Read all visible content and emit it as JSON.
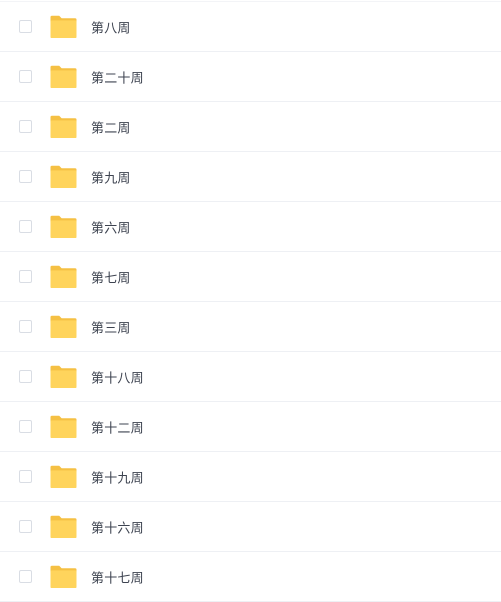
{
  "file_list": {
    "items": [
      {
        "name": "第八周",
        "icon": "folder-icon",
        "checked": false
      },
      {
        "name": "第二十周",
        "icon": "folder-icon",
        "checked": false
      },
      {
        "name": "第二周",
        "icon": "folder-icon",
        "checked": false
      },
      {
        "name": "第九周",
        "icon": "folder-icon",
        "checked": false
      },
      {
        "name": "第六周",
        "icon": "folder-icon",
        "checked": false
      },
      {
        "name": "第七周",
        "icon": "folder-icon",
        "checked": false
      },
      {
        "name": "第三周",
        "icon": "folder-icon",
        "checked": false
      },
      {
        "name": "第十八周",
        "icon": "folder-icon",
        "checked": false
      },
      {
        "name": "第十二周",
        "icon": "folder-icon",
        "checked": false
      },
      {
        "name": "第十九周",
        "icon": "folder-icon",
        "checked": false
      },
      {
        "name": "第十六周",
        "icon": "folder-icon",
        "checked": false
      },
      {
        "name": "第十七周",
        "icon": "folder-icon",
        "checked": false
      }
    ]
  },
  "colors": {
    "folder": "#FFD45C",
    "folder_tab": "#F5C043",
    "text": "#3D4350",
    "divider": "#EEF0F4",
    "checkbox_border": "#D9DDE4"
  }
}
